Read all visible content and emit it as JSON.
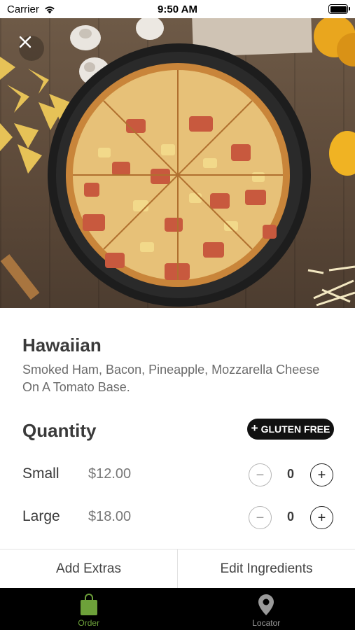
{
  "status_bar": {
    "carrier": "Carrier",
    "time": "9:50 AM"
  },
  "hero": {
    "close_icon": "close-icon",
    "image_subject": "pizza-photo"
  },
  "product": {
    "name": "Hawaiian",
    "description": "Smoked Ham, Bacon, Pineapple, Mozzarella Cheese On A Tomato Base."
  },
  "quantity": {
    "title": "Quantity",
    "gluten_free_label": "GLUTEN FREE",
    "sizes": [
      {
        "label": "Small",
        "price": "$12.00",
        "count": "0"
      },
      {
        "label": "Large",
        "price": "$18.00",
        "count": "0"
      }
    ]
  },
  "actions": {
    "add_extras": "Add Extras",
    "edit_ingredients": "Edit Ingredients"
  },
  "tab_bar": {
    "items": [
      {
        "label": "Order",
        "icon": "shopping-bag-icon",
        "active": true
      },
      {
        "label": "Locator",
        "icon": "location-pin-icon",
        "active": false
      }
    ]
  },
  "colors": {
    "accent": "#6da13a",
    "tab_bar_bg": "#000000",
    "gluten_free_bg": "#111111",
    "text_primary": "#3a3a3a",
    "text_secondary": "#6b6b6b"
  }
}
